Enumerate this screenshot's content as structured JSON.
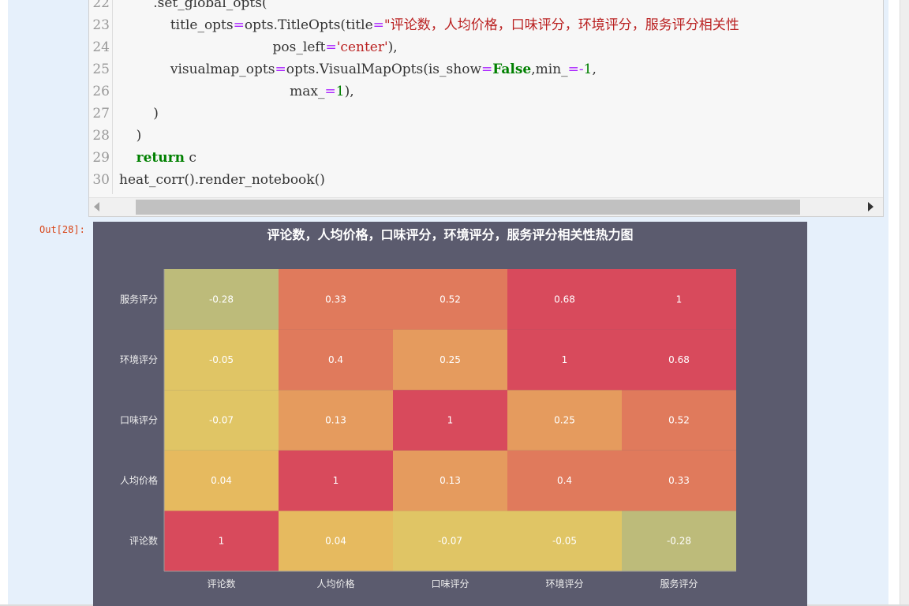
{
  "notebook": {
    "out_prompt": "Out[28]:",
    "code_lines": [
      {
        "num": "22",
        "tokens": [
          [
            "",
            "        .set_global_opts("
          ]
        ]
      },
      {
        "num": "23",
        "tokens": [
          [
            "",
            "            title_opts"
          ],
          [
            "op",
            "="
          ],
          [
            "",
            "opts.TitleOpts(title"
          ],
          [
            "op",
            "="
          ],
          [
            "str",
            "\"评论数，人均价格，口味评分，环境评分，服务评分相关性"
          ]
        ]
      },
      {
        "num": "24",
        "tokens": [
          [
            "",
            "                                    pos_left"
          ],
          [
            "op",
            "="
          ],
          [
            "str",
            "'center'"
          ],
          [
            "",
            "),"
          ]
        ]
      },
      {
        "num": "25",
        "tokens": [
          [
            "",
            "            visualmap_opts"
          ],
          [
            "op",
            "="
          ],
          [
            "",
            "opts.VisualMapOpts(is_show"
          ],
          [
            "op",
            "="
          ],
          [
            "kw",
            "False"
          ],
          [
            "",
            ",min_"
          ],
          [
            "op",
            "=-"
          ],
          [
            "num",
            "1"
          ],
          [
            "",
            ","
          ]
        ]
      },
      {
        "num": "26",
        "tokens": [
          [
            "",
            "                                        max_"
          ],
          [
            "op",
            "="
          ],
          [
            "num",
            "1"
          ],
          [
            "",
            "),"
          ]
        ]
      },
      {
        "num": "27",
        "tokens": [
          [
            "",
            "        )"
          ]
        ]
      },
      {
        "num": "28",
        "tokens": [
          [
            "",
            "    )"
          ]
        ]
      },
      {
        "num": "29",
        "tokens": [
          [
            "",
            "    "
          ],
          [
            "kw",
            "return"
          ],
          [
            "",
            " c"
          ]
        ]
      },
      {
        "num": "30",
        "tokens": [
          [
            "",
            "heat_corr().render_notebook()"
          ]
        ]
      }
    ]
  },
  "colors": {
    "chart_background": "#5b5b6e",
    "text_light": "#eeeeee",
    "grid_line": "#999999",
    "palette": [
      "#bdbb7a",
      "#e0c565",
      "#e6ba5f",
      "#e59b5e",
      "#e07a5c",
      "#d84a5c"
    ]
  },
  "chart_data": {
    "type": "heatmap",
    "title": "评论数，人均价格，口味评分，环境评分，服务评分相关性热力图",
    "x_categories": [
      "评论数",
      "人均价格",
      "口味评分",
      "环境评分",
      "服务评分"
    ],
    "y_categories": [
      "评论数",
      "人均价格",
      "口味评分",
      "环境评分",
      "服务评分"
    ],
    "visualmap": {
      "min": -1,
      "max": 1,
      "shown": false
    },
    "matrix": [
      [
        1,
        0.04,
        -0.07,
        -0.05,
        -0.28
      ],
      [
        0.04,
        1,
        0.13,
        0.4,
        0.33
      ],
      [
        -0.07,
        0.13,
        1,
        0.25,
        0.52
      ],
      [
        -0.05,
        0.4,
        0.25,
        1,
        0.68
      ],
      [
        -0.28,
        0.33,
        0.52,
        0.68,
        1
      ]
    ],
    "cell_labels_shown": true,
    "legend": "none"
  }
}
